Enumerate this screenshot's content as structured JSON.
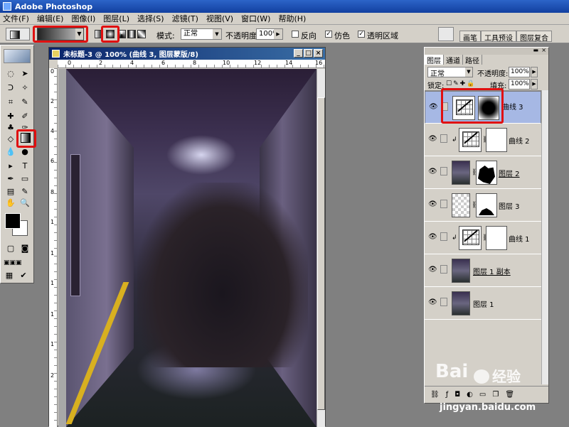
{
  "app": {
    "title": "Adobe Photoshop"
  },
  "menu": [
    "文件(F)",
    "编辑(E)",
    "图像(I)",
    "图层(L)",
    "选择(S)",
    "滤镜(T)",
    "视图(V)",
    "窗口(W)",
    "帮助(H)"
  ],
  "options": {
    "mode_label": "模式:",
    "mode_value": "正常",
    "opacity_label": "不透明度:",
    "opacity_value": "100%",
    "reverse_label": "反向",
    "dither_label": "仿色",
    "transparency_label": "透明区域",
    "palette_tabs": [
      "画笔",
      "工具预设",
      "图层复合"
    ]
  },
  "document": {
    "title": "未标题-3 @ 100% (曲线 3, 图层蒙版/8)",
    "ruler_top": [
      "0",
      "2",
      "4",
      "6",
      "8",
      "10",
      "12",
      "14",
      "16"
    ],
    "ruler_left": [
      "0",
      "2",
      "4",
      "6",
      "8",
      "1",
      "1",
      "1",
      "1",
      "1",
      "2"
    ]
  },
  "layers_panel": {
    "tabs": [
      "图层",
      "通道",
      "路径"
    ],
    "blend_mode": "正常",
    "opacity_label": "不透明度:",
    "opacity_value": "100%",
    "lock_label": "锁定:",
    "fill_label": "填充:",
    "fill_value": "100%",
    "layers": [
      {
        "name": "曲线 3",
        "type": "adjustment",
        "mask": "dark",
        "selected": true
      },
      {
        "name": "曲线 2",
        "type": "adjustment",
        "mask": "white",
        "clipped": true
      },
      {
        "name": "图层 2",
        "type": "image",
        "mask": "shape1"
      },
      {
        "name": "图层 3",
        "type": "checker",
        "mask": "shape2"
      },
      {
        "name": "曲线 1",
        "type": "adjustment",
        "mask": "white",
        "clipped": true
      },
      {
        "name": "图层 1 副本",
        "type": "image"
      },
      {
        "name": "图层 1",
        "type": "image"
      }
    ]
  },
  "watermark": {
    "brand": "Bai",
    "brand2": "经验",
    "url": "jingyan.baidu.com"
  },
  "colors": {
    "highlight": "#e01010",
    "selected_layer": "#a6b8e4"
  }
}
